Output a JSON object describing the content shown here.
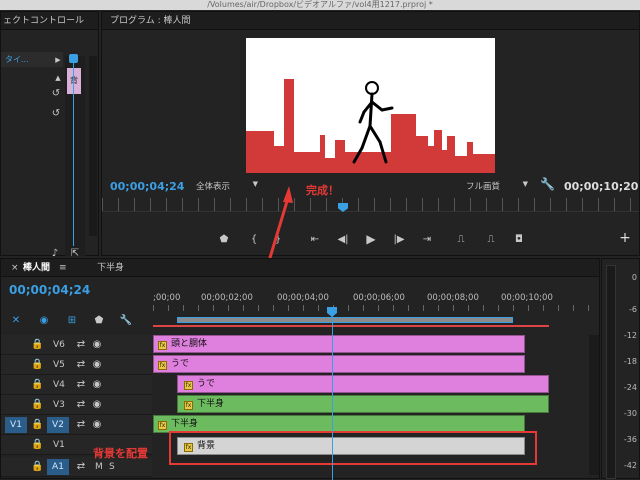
{
  "window": {
    "title": "/Volumes/air/Dropbox/ビデオアルファ/vol4用1217.prproj *"
  },
  "effect_controls": {
    "tab_label": "ェクトコントロール",
    "row_label": "タイ...",
    "clip_marker": "背"
  },
  "program_monitor": {
    "tab_label": "プログラム : 棒人間",
    "timecode_current": "00;00;04;24",
    "timecode_duration": "00;00;10;20",
    "zoom_select": "全体表示",
    "quality_select": "フル画質"
  },
  "timeline": {
    "tabs": [
      {
        "label": "棒人間",
        "active": true
      },
      {
        "label": "下半身",
        "active": false
      }
    ],
    "timecode": "00;00;04;24",
    "ruler_ticks": [
      ";00;00",
      "00;00;02;00",
      "00;00;04;00",
      "00;00;06;00",
      "00;00;08;00",
      "00;00;10;00"
    ],
    "tracks": [
      {
        "patch": "",
        "name": "V6",
        "clip": "頭と胴体",
        "color": "pink"
      },
      {
        "patch": "",
        "name": "V5",
        "clip": "うで",
        "color": "pink"
      },
      {
        "patch": "",
        "name": "V4",
        "clip": "うで",
        "color": "pink"
      },
      {
        "patch": "",
        "name": "V3",
        "clip": "下半身",
        "color": "green"
      },
      {
        "patch": "V1",
        "name": "V2",
        "clip": "下半身",
        "color": "green"
      },
      {
        "patch": "",
        "name": "V1",
        "clip": "背景",
        "color": "gray"
      },
      {
        "patch": "",
        "name": "A1",
        "clip": "",
        "color": ""
      }
    ],
    "audio_track_buttons": [
      "M",
      "S"
    ]
  },
  "audio_meter": {
    "labels": [
      "0",
      "-6",
      "-12",
      "-18",
      "-24",
      "-30",
      "-36",
      "-42"
    ]
  },
  "annotations": {
    "complete": "完成！",
    "background": "背景を配置"
  },
  "colors": {
    "accent_blue": "#3b9fe4",
    "annotation_red": "#e53935",
    "clip_pink": "#e080de",
    "clip_green": "#6dbb5f",
    "clip_gray": "#d4d4d4"
  }
}
